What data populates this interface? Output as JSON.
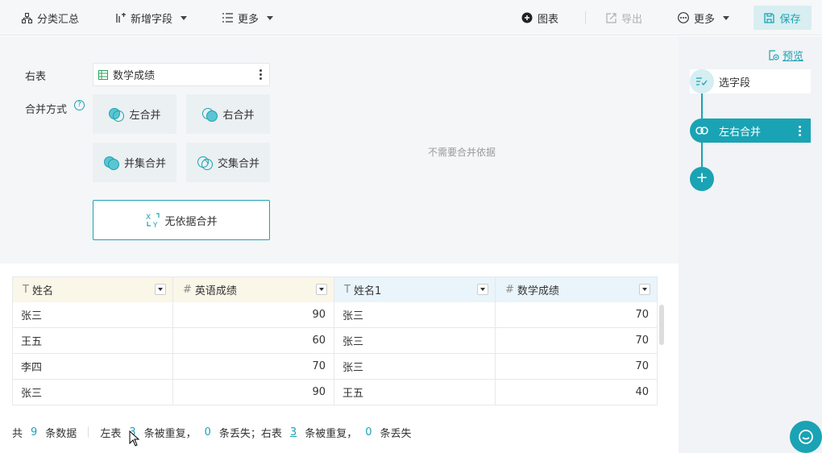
{
  "toolbar": {
    "group_summary": "分类汇总",
    "add_field": "新增字段",
    "more_left": "更多",
    "chart": "图表",
    "export": "导出",
    "more_right": "更多",
    "save": "保存"
  },
  "config": {
    "right_table_label": "右表",
    "right_table_value": "数学成绩",
    "merge_mode_label": "合并方式",
    "help": "?",
    "options": [
      "左合并",
      "右合并",
      "并集合并",
      "交集合并",
      "无依据合并"
    ],
    "selected": "无依据合并",
    "no_basis_text": "不需要合并依据"
  },
  "panel": {
    "preview": "预览",
    "node_select": "选字段",
    "node_merge": "左右合并",
    "add": "+"
  },
  "table": {
    "columns": [
      {
        "type_icon": "T",
        "name": "姓名",
        "side": "left"
      },
      {
        "type_icon": "#",
        "name": "英语成绩",
        "side": "left"
      },
      {
        "type_icon": "T",
        "name": "姓名1",
        "side": "right"
      },
      {
        "type_icon": "#",
        "name": "数学成绩",
        "side": "right"
      }
    ],
    "rows": [
      [
        "张三",
        "90",
        "张三",
        "70"
      ],
      [
        "王五",
        "60",
        "张三",
        "70"
      ],
      [
        "李四",
        "70",
        "张三",
        "70"
      ],
      [
        "张三",
        "90",
        "王五",
        "40"
      ]
    ]
  },
  "footer": {
    "total_prefix": "共",
    "total_count": "9",
    "total_suffix": "条数据",
    "left_label": "左表",
    "left_dup": "3",
    "dup_text": "条被重复，",
    "left_lost": "0",
    "lost_text_sep": "条丢失；右表",
    "right_dup": "3",
    "dup_text2": "条被重复，",
    "right_lost": "0",
    "lost_text": "条丢失"
  }
}
